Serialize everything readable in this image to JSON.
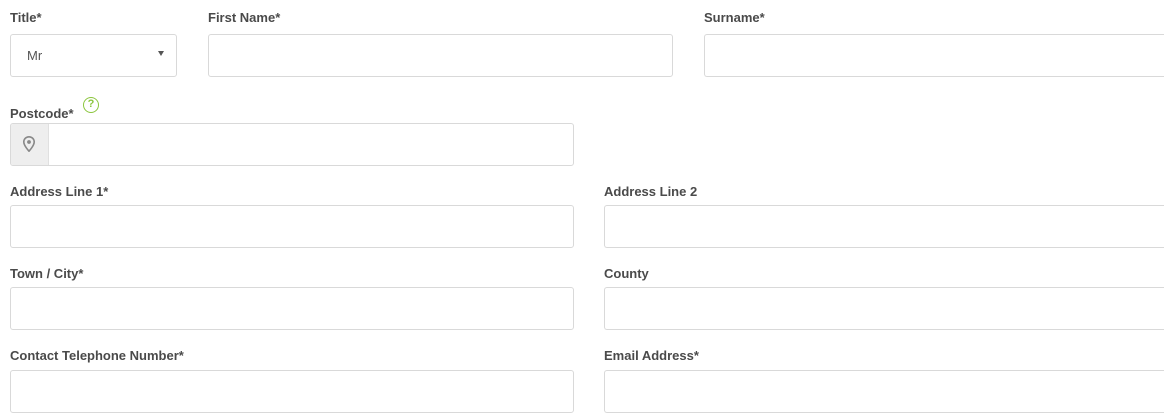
{
  "form": {
    "title": {
      "label": "Title*",
      "selected": "Mr"
    },
    "first_name": {
      "label": "First Name*",
      "value": ""
    },
    "surname": {
      "label": "Surname*",
      "value": ""
    },
    "postcode": {
      "label": "Postcode*",
      "help_icon": "question-circle-icon",
      "help_glyph": "?",
      "addon_icon": "map-marker-icon",
      "value": ""
    },
    "address_line_1": {
      "label": "Address Line 1*",
      "value": ""
    },
    "address_line_2": {
      "label": "Address Line 2",
      "value": ""
    },
    "town_city": {
      "label": "Town / City*",
      "value": ""
    },
    "county": {
      "label": "County",
      "value": ""
    },
    "telephone": {
      "label": "Contact Telephone Number*",
      "value": ""
    },
    "email": {
      "label": "Email Address*",
      "value": ""
    }
  },
  "colors": {
    "label_text": "#4a4a4a",
    "border": "#d9d9d9",
    "addon_bg": "#eeeeee",
    "help_accent": "#8cc63f"
  }
}
